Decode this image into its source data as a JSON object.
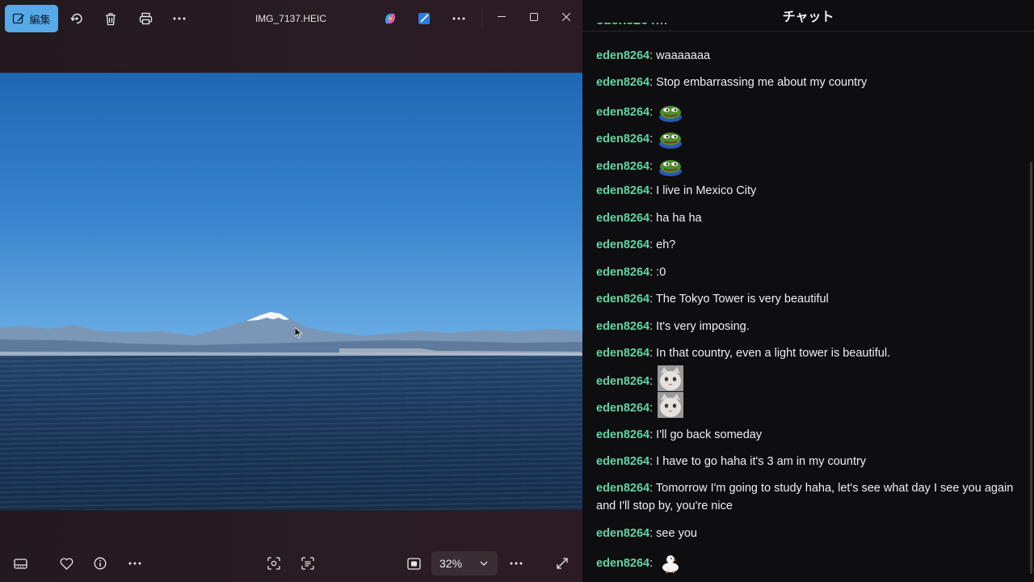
{
  "viewer": {
    "edit_label": "編集",
    "file_title": "IMG_7137.HEIC",
    "zoom_value": "32%",
    "icons": [
      "edit-icon",
      "rotate-icon",
      "delete-icon",
      "print-icon",
      "more-icon",
      "copilot-icon",
      "designer-icon",
      "more-icon",
      "minimize-icon",
      "maximize-icon",
      "close-icon",
      "filmstrip-icon",
      "heart-icon",
      "info-icon",
      "more-icon",
      "visual-search-icon",
      "text-scan-icon",
      "fit-icon",
      "chevron-down-icon",
      "more-icon",
      "fullscreen-icon"
    ]
  },
  "chat": {
    "title": "チャット",
    "username": "eden8264",
    "partial_top_text": "…",
    "messages": [
      {
        "text": "waaaaaaa"
      },
      {
        "text": "Stop embarrassing me about my country"
      },
      {
        "emote": "pepe-emote"
      },
      {
        "emote": "pepe-emote"
      },
      {
        "emote": "pepe-emote"
      },
      {
        "text": "I live in Mexico City"
      },
      {
        "text": "ha ha ha"
      },
      {
        "text": "eh?"
      },
      {
        "text": ":0"
      },
      {
        "text": "The Tokyo Tower is very beautiful"
      },
      {
        "text": "It's very imposing."
      },
      {
        "text": "In that country, even a light tower is beautiful."
      },
      {
        "emote": "cat-emote"
      },
      {
        "emote": "cat-emote"
      },
      {
        "text": "I'll go back someday"
      },
      {
        "text": "I have to go haha it's 3 am in my country"
      },
      {
        "text": "Tomorrow I'm going to study haha, let's see what day I see you again and I'll stop by, you're nice"
      },
      {
        "text": "see you"
      },
      {
        "emote": "duck-emote"
      }
    ]
  },
  "colors": {
    "accent": "#58a9e8",
    "username": "#5fd6a6",
    "chat_bg": "#0e0e10"
  }
}
